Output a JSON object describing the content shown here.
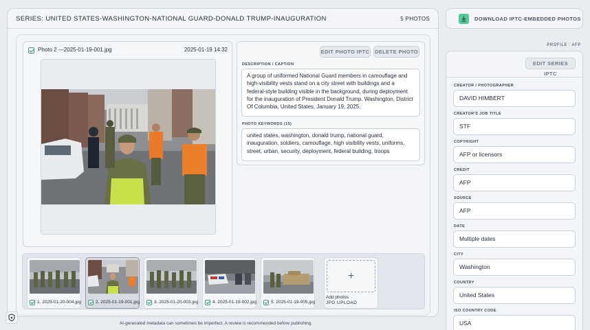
{
  "header": {
    "series_title": "SERIES: UNITED STATES-WASHINGTON-NATIONAL GUARD-DONALD TRUMP-INAUGURATION",
    "photo_count": "5 PHOTOS"
  },
  "photo": {
    "name": "Photo 2 —2025-01-19-001.jpg",
    "date": "2025-01-19 14:32",
    "checked": true
  },
  "actions": {
    "edit_photo": "EDIT PHOTO IPTC",
    "delete_photo": "DELETE PHOTO",
    "download": "DOWNLOAD IPTC-EMBEDDED PHOTOS",
    "edit_series": "EDIT SERIES IPTC"
  },
  "description": {
    "label": "DESCRIPTION / CAPTION",
    "text": "A group of uniformed National Guard members in camouflage and high-visibility vests stand on a city street with buildings and a federal-style building visible in the background, during deployment for the inauguration of President Donald Trump. Washington, District Of Columbia, United States, January 19, 2025."
  },
  "keywords": {
    "label": "PHOTO KEYWORDS (15)",
    "text": "united states, washington, donald trump, national guard, inauguration, soldiers, camouflage, high visibility vests, uniforms, street, urban, security, deployment, federal building, troops"
  },
  "thumbnails": [
    {
      "label": "1. 2025-01-20-004.jpg",
      "selected": false
    },
    {
      "label": "2. 2025-01-19-001.jpg",
      "selected": true
    },
    {
      "label": "3. 2025-01-20-003.jpg",
      "selected": false
    },
    {
      "label": "4. 2025-01-19-002.jpg",
      "selected": false
    },
    {
      "label": "5. 2025-01-19-005.jpg",
      "selected": false
    }
  ],
  "add_photos": {
    "label": "Add photos",
    "sub": "JPG UPLOAD",
    "icon": "+"
  },
  "disclaimer": "AI-generated metadata can sometimes be imperfect. A review is recommended before publishing.",
  "profile": "PROFILE : AFP",
  "fields": [
    {
      "label": "CREATOR / PHOTOGRAPHER",
      "value": "DAVID HIMBERT"
    },
    {
      "label": "CREATOR'S JOB TITLE",
      "value": "STF"
    },
    {
      "label": "COPYRIGHT",
      "value": "AFP or licensors"
    },
    {
      "label": "CREDIT",
      "value": "AFP"
    },
    {
      "label": "SOURCE",
      "value": "AFP"
    },
    {
      "label": "DATE",
      "value": "Multiple dates"
    },
    {
      "label": "CITY",
      "value": "Washington"
    },
    {
      "label": "COUNTRY",
      "value": "United States"
    },
    {
      "label": "ISO COUNTRY CODE",
      "value": "USA"
    }
  ],
  "colors": {
    "accent_green": "#57c796",
    "check_green": "#3a9d7c",
    "panel_bg": "#f3f5f8",
    "page_bg": "#e9edf2"
  }
}
